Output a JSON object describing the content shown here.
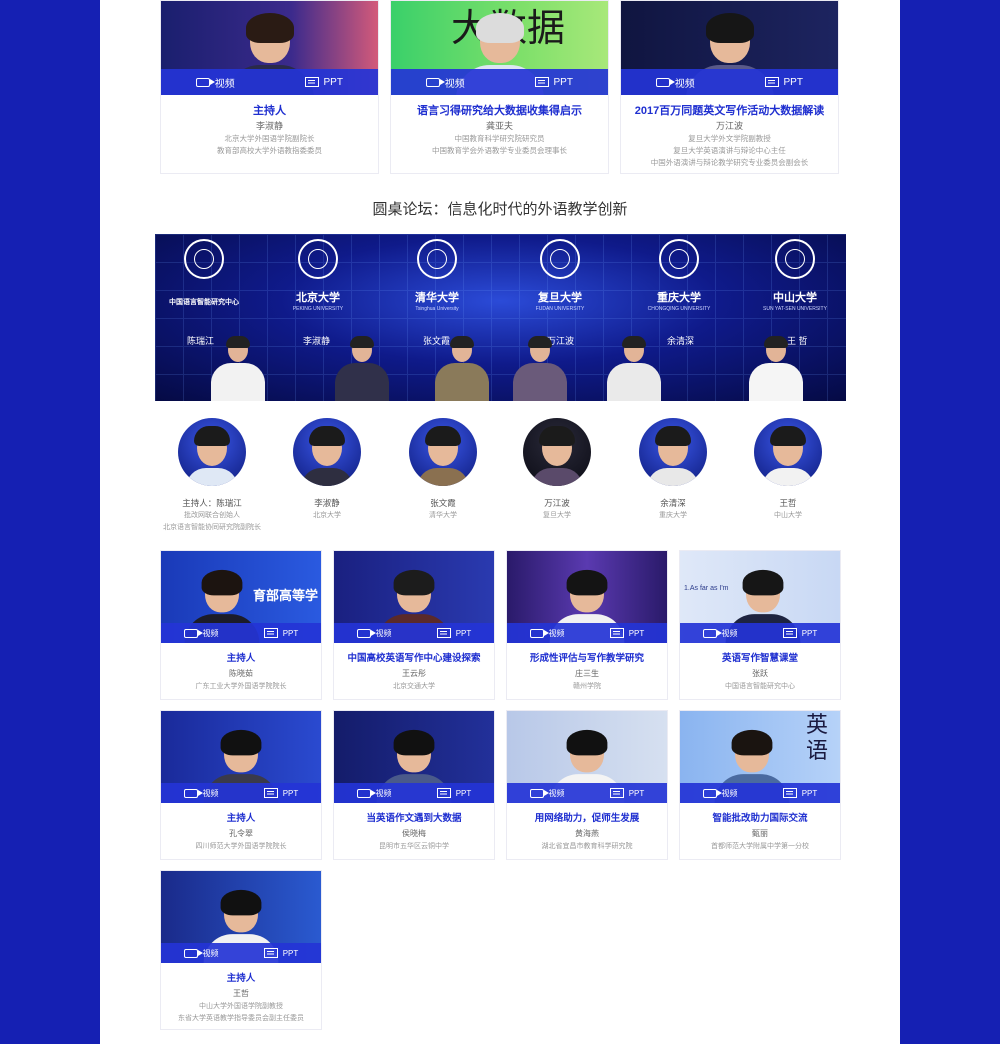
{
  "colors": {
    "accent": "#1f2fd0",
    "outer_bg": "#1520b3",
    "bar": "#2434d6"
  },
  "labels": {
    "video": "视频",
    "ppt": "PPT"
  },
  "top_row": [
    {
      "title": "主持人",
      "name": "李淑静",
      "desc": [
        "北京大学外国语学院副院长",
        "教育部高校大学外语教指委委员"
      ]
    },
    {
      "title": "语言习得研究给大数据收集得启示",
      "name": "龚亚夫",
      "desc": [
        "中国教育科学研究院研究员",
        "中国教育学会外语教学专业委员会理事长"
      ]
    },
    {
      "title": "2017百万同题英文写作活动大数据解读",
      "name": "万江波",
      "desc": [
        "复旦大学外文学院副教授",
        "复旦大学英语演讲与辩论中心主任",
        "中国外语演讲与辩论教学研究专业委员会副会长"
      ]
    }
  ],
  "forum_title": "圆桌论坛：信息化时代的外语教学创新",
  "banner": {
    "logos": [
      {
        "name": "中国语言智能研究中心",
        "sub": ""
      },
      {
        "name": "北京大学",
        "sub": "PEKING UNIVERSITY"
      },
      {
        "name": "清华大学",
        "sub": "Tsinghua University"
      },
      {
        "name": "复旦大学",
        "sub": "FUDAN UNIVERSITY"
      },
      {
        "name": "重庆大学",
        "sub": "CHONGQING UNIVERSITY"
      },
      {
        "name": "中山大学",
        "sub": "SUN YAT-SEN UNIVERSITY"
      }
    ],
    "names": [
      "陈瑞江",
      "李淑静",
      "张文霞",
      "万江波",
      "余清深",
      "王 哲"
    ]
  },
  "panelists": [
    {
      "name": "主持人：陈瑞江",
      "desc": [
        "批改网联合创始人",
        "北京语言智能协同研究院副院长"
      ]
    },
    {
      "name": "李淑静",
      "desc": [
        "北京大学"
      ]
    },
    {
      "name": "张文霞",
      "desc": [
        "清华大学"
      ]
    },
    {
      "name": "万江波",
      "desc": [
        "复旦大学"
      ]
    },
    {
      "name": "余清深",
      "desc": [
        "重庆大学"
      ]
    },
    {
      "name": "王哲",
      "desc": [
        "中山大学"
      ]
    }
  ],
  "grid_row1": [
    {
      "title": "主持人",
      "name": "陈晓茹",
      "desc": [
        "广东工业大学外国语学院院长"
      ],
      "photo_text": "育部高等学"
    },
    {
      "title": "中国高校英语写作中心建设探索",
      "name": "王云彤",
      "desc": [
        "北京交通大学"
      ],
      "photo_text": ""
    },
    {
      "title": "形成性评估与写作教学研究",
      "name": "庄三生",
      "desc": [
        "赣州学院"
      ],
      "photo_text": ""
    },
    {
      "title": "英语写作智慧课堂",
      "name": "张跃",
      "desc": [
        "中国语言智能研究中心"
      ],
      "photo_text": "1.As far as I'm"
    }
  ],
  "grid_row2": [
    {
      "title": "主持人",
      "name": "孔令翠",
      "desc": [
        "四川师范大学外国语学院院长"
      ]
    },
    {
      "title": "当英语作文遇到大数据",
      "name": "侯晓梅",
      "desc": [
        "昆明市五华区云铜中学"
      ]
    },
    {
      "title": "用网络助力，促师生发展",
      "name": "黄海燕",
      "desc": [
        "湖北省宜昌市教育科学研究院"
      ]
    },
    {
      "title": "智能批改助力国际交流",
      "name": "甄丽",
      "desc": [
        "首都师范大学附属中学第一分校"
      ],
      "photo_text": "英 语"
    }
  ],
  "grid_row3": [
    {
      "title": "主持人",
      "name": "王哲",
      "desc": [
        "中山大学外国语学院副教授",
        "东省大学英语教学指导委员会副主任委员"
      ]
    }
  ]
}
